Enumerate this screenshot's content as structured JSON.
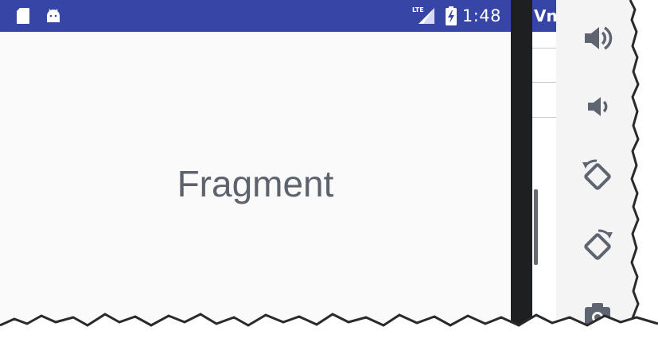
{
  "status_bar": {
    "time": "1:48",
    "network_label": "LTE",
    "left_icons": [
      "sd-card-icon",
      "android-icon"
    ],
    "right_icons": [
      "signal-icon",
      "battery-charging-icon"
    ],
    "background": "#3746a6"
  },
  "main": {
    "fragment_text": "Fragment"
  },
  "back_window": {
    "title_fragment": "Vn"
  },
  "emulator_toolbar": {
    "buttons": [
      {
        "name": "volume-up-button",
        "icon": "volume-up-icon"
      },
      {
        "name": "volume-down-button",
        "icon": "volume-down-icon"
      },
      {
        "name": "rotate-left-button",
        "icon": "rotate-left-icon"
      },
      {
        "name": "rotate-right-button",
        "icon": "rotate-right-icon"
      },
      {
        "name": "screenshot-button",
        "icon": "camera-icon"
      }
    ]
  }
}
